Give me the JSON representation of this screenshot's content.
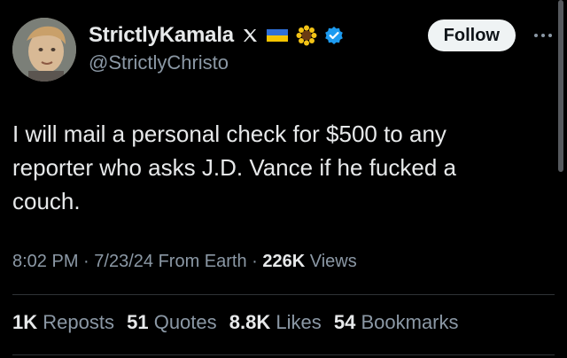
{
  "author": {
    "display_name": "StrictlyKamala",
    "handle": "@StrictlyChristo",
    "badges": [
      "x-logo-icon",
      "ukraine-flag-icon",
      "sunflower-icon",
      "verified-badge-icon"
    ]
  },
  "follow_button": {
    "label": "Follow"
  },
  "tweet": {
    "text": "I will mail a personal check for $500 to any reporter who asks J.D. Vance if he fucked a couch."
  },
  "meta": {
    "time": "8:02 PM",
    "separator": " · ",
    "date": "7/23/24",
    "source": "From Earth",
    "views_count": "226K",
    "views_label": "Views"
  },
  "stats": [
    {
      "count": "1K",
      "label": "Reposts"
    },
    {
      "count": "51",
      "label": "Quotes"
    },
    {
      "count": "8.8K",
      "label": "Likes"
    },
    {
      "count": "54",
      "label": "Bookmarks"
    }
  ],
  "colors": {
    "background": "#000000",
    "primary_text": "#e7e9ea",
    "secondary_text": "#8b98a5",
    "verified_blue": "#1d9bf0",
    "follow_bg": "#eff3f4",
    "divider": "#2f3336"
  }
}
